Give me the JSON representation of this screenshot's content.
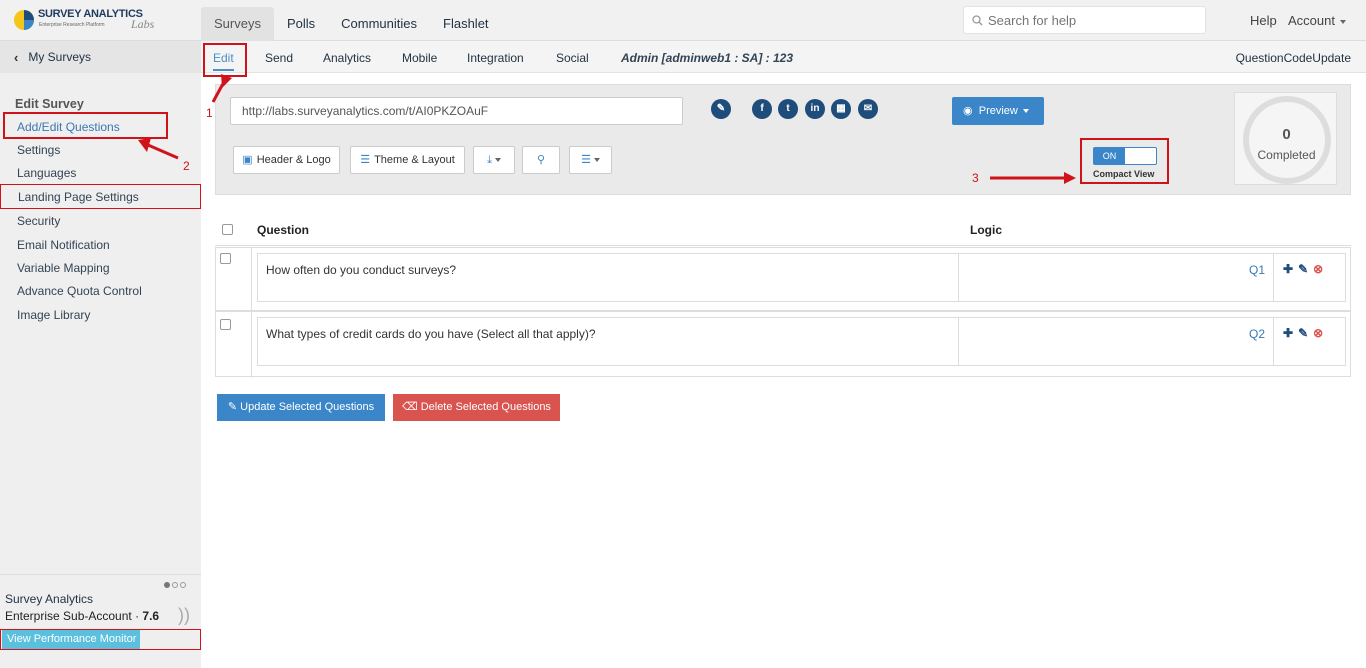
{
  "logo": {
    "brand": "SURVEY ANALYTICS",
    "tagline": "Enterprise Research Platform",
    "suffix": "Labs"
  },
  "top_tabs": [
    "Surveys",
    "Polls",
    "Communities",
    "Flashlet"
  ],
  "search": {
    "placeholder": "Search for help"
  },
  "top_right": {
    "help": "Help",
    "account": "Account"
  },
  "sidebar": {
    "back_label": "My Surveys",
    "section_title": "Edit Survey",
    "items": [
      "Add/Edit Questions",
      "Settings",
      "Languages",
      "Landing Page Settings",
      "Security",
      "Email Notification",
      "Variable Mapping",
      "Advance Quota Control",
      "Image Library"
    ],
    "footer": {
      "name": "Survey Analytics",
      "sub_prefix": "Enterprise Sub-Account · ",
      "version": "7.6",
      "perf_button": "View Performance Monitor"
    }
  },
  "subnav": {
    "tabs": [
      "Edit",
      "Send",
      "Analytics",
      "Mobile",
      "Integration",
      "Social"
    ],
    "admin": "Admin [adminweb1 : SA] : 123",
    "right_link": "QuestionCodeUpdate"
  },
  "panel": {
    "url": "http://labs.surveyanalytics.com/t/AI0PKZOAuF",
    "preview": "Preview",
    "buttons": {
      "header_logo": "Header & Logo",
      "theme_layout": "Theme & Layout"
    },
    "toggle_on": "ON",
    "compact_view": "Compact View",
    "completed_count": "0",
    "completed_label": "Completed"
  },
  "table": {
    "headers": {
      "question": "Question",
      "logic": "Logic"
    },
    "rows": [
      {
        "text": "How often do you conduct surveys?",
        "code": "Q1"
      },
      {
        "text": "What types of credit cards do you have (Select all that apply)?",
        "code": "Q2"
      }
    ]
  },
  "actions": {
    "update": "Update Selected Questions",
    "delete": "Delete Selected Questions"
  },
  "annotations": [
    "1",
    "2",
    "3"
  ],
  "colors": {
    "accent": "#3a86c8",
    "danger": "#d9534f",
    "highlight": "#d0121b"
  }
}
